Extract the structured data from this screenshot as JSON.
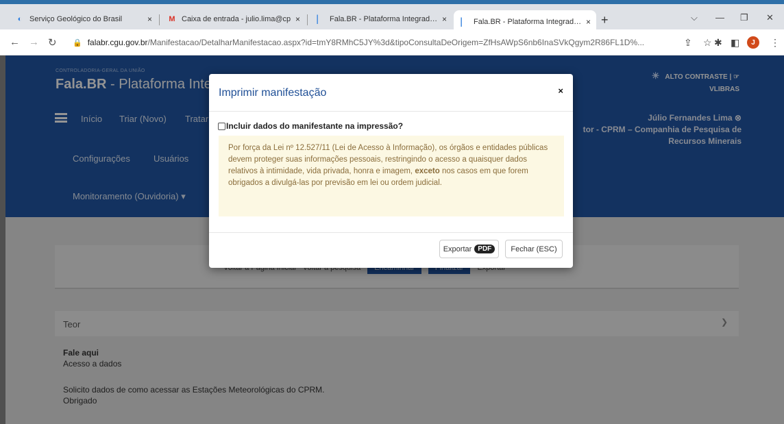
{
  "browser": {
    "tabs": [
      {
        "title": "Serviço Geológico do Brasil",
        "close": "×"
      },
      {
        "title": "Caixa de entrada - julio.lima@cp",
        "close": "×"
      },
      {
        "title": "Fala.BR - Plataforma Integrada d",
        "close": "×"
      },
      {
        "title": "Fala.BR - Plataforma Integrada d",
        "close": "×",
        "active": true
      }
    ],
    "new_tab": "+",
    "url_domain": "falabr.cgu.gov.br",
    "url_path": "/Manifestacao/DetalharManifestacao.aspx?id=tmY8RMhC5JY%3d&tipoConsultaDeOrigem=ZfHsAWpS6nb6InaSVkQgym2R86FL1D%...",
    "profile_initial": "J"
  },
  "page": {
    "org": "CONTROLADORIA-GERAL DA UNIÃO",
    "brand_bold": "Fala.BR",
    "brand_rest": " - Plataforma Integ",
    "nav": {
      "inicio": "Início",
      "triar": "Triar (Novo)",
      "tratar": "Tratar",
      "configuracoes": "Configurações",
      "usuarios": "Usuários",
      "monitoramento": "Monitoramento (Ouvidoria) ▾"
    },
    "contrast_line1": "ALTO CONTRASTE | ☞",
    "contrast_line2": "VLIBRAS",
    "user_name": "Júlio Fernandes Lima ⊗",
    "user_org_line1": "tor - CPRM – Companhia de Pesquisa de",
    "user_org_line2": "Recursos Minerais",
    "card_buttons": [
      "Voltar à Página Inicial",
      "Voltar à pesquisa",
      "Encaminhar",
      "Finalizar",
      "Exportar"
    ],
    "teor_label": "Teor",
    "fale_aqui": "Fale aqui",
    "assunto": "Acesso a dados",
    "mensagem1": "Solicito  dados de como acessar as Estações Meteorológicas do CPRM.",
    "mensagem2": "Obrigado"
  },
  "modal": {
    "title": "Imprimir manifestação",
    "close": "×",
    "checkbox_label": "Incluir dados do manifestante na impressão?",
    "checkbox_checked": false,
    "warning_before": "Por força da Lei nº 12.527/11 (Lei de Acesso à Informação), os órgãos e entidades públicas devem proteger suas informações pessoais, restringindo o acesso a quaisquer dados relativos à intimidade, vida privada, honra e imagem, ",
    "warning_bold": "exceto",
    "warning_after": " nos casos em que forem obrigados a divulgá-las por previsão em lei ou ordem judicial.",
    "export_label": "Exportar",
    "export_badge": "PDF",
    "close_button": "Fechar (ESC)"
  },
  "colors": {
    "header_blue": "#2157a6",
    "title_blue": "#1f4f96",
    "warning_bg": "#fcf8e3",
    "warning_text": "#8a6d3b"
  }
}
